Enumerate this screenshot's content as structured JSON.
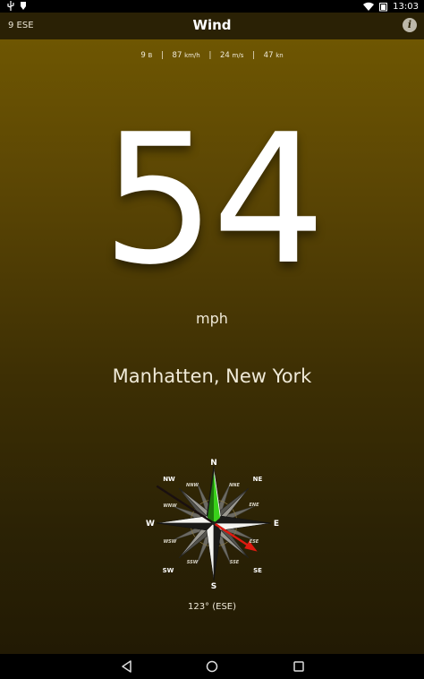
{
  "status_bar": {
    "time": "13:03"
  },
  "app_bar": {
    "left_info": "9  ESE",
    "title": "Wind",
    "info_button_label": "i"
  },
  "units": [
    {
      "value": "9",
      "unit": "B"
    },
    {
      "value": "87",
      "unit": "km/h"
    },
    {
      "value": "24",
      "unit": "m/s"
    },
    {
      "value": "47",
      "unit": "kn"
    }
  ],
  "speed": {
    "value": "54",
    "unit": "mph"
  },
  "location": "Manhatten, New York",
  "compass": {
    "direction_degrees": 123,
    "cardinals": {
      "n": "N",
      "e": "E",
      "s": "S",
      "w": "W"
    },
    "intercardinals": {
      "ne": "NE",
      "se": "SE",
      "sw": "SW",
      "nw": "NW"
    },
    "secondary": {
      "nne": "NNE",
      "ene": "ENE",
      "ese": "ESE",
      "sse": "SSE",
      "ssw": "SSW",
      "wsw": "WSW",
      "wnw": "WNW",
      "nnw": "NNW"
    },
    "bearing_label": "123° (ESE)"
  },
  "colors": {
    "needle_north": "#39d11a",
    "wind_arrow": "#e01a10",
    "header_bg": "#2a2105"
  }
}
